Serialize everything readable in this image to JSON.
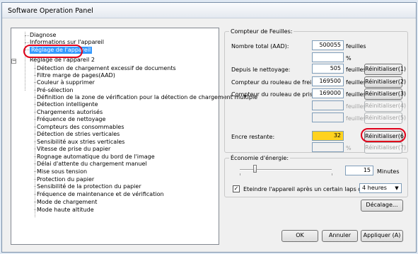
{
  "window": {
    "title": "Software Operation Panel"
  },
  "tree": {
    "expander_glyph": "−",
    "items": [
      "Diagnose",
      "Informations sur l'appareil",
      "Réglage de l'appareil",
      "Réglage de l'appareil 2",
      "Détection de chargement excessif de documents",
      "Filtre marge de pages(AAD)",
      "Couleur à supprimer",
      "Pré-sélection",
      "Définition de la zone de vérification pour la détection de chargement multiple",
      "Détection intelligente",
      "Chargements autorisés",
      "Fréquence de nettoyage",
      "Compteurs des consommables",
      "Détection de stries verticales",
      "Sensibilité aux stries verticales",
      "Vitesse de prise du papier",
      "Rognage automatique du bord de l'image",
      "Délai d'attente du chargement manuel",
      "Mise sous tension",
      "Protection du papier",
      "Sensibilité de la protection du papier",
      "Fréquence de maintenance et de vérification",
      "Mode de chargement",
      "Mode haute altitude"
    ]
  },
  "counter": {
    "legend": "Compteur de Feuilles:",
    "total_label": "Nombre total (AAD):",
    "total_value": "500055",
    "total_unit": "feuilles",
    "percent_unit": "%",
    "since_cleaning_label": "Depuis le nettoyage:",
    "since_cleaning_value": "505",
    "since_cleaning_unit": "feuilles",
    "reset1": "Réinitialiser(1)",
    "brake_label": "Compteur du rouleau de frein:",
    "brake_value": "169500",
    "brake_unit": "feuilles",
    "reset2": "Réinitialiser(2)",
    "pick_label": "Compteur du rouleau de prise :",
    "pick_value": "169000",
    "pick_unit": "feuilles",
    "reset3": "Réinitialiser(3)",
    "blank4_unit": "feuilles",
    "reset4": "Réinitialiser(4)",
    "blank5_unit": "feuilles",
    "reset5": "Réinitialiser(5)",
    "ink_label": "Encre restante:",
    "ink_value": "32",
    "reset6": "Réinitialiser(6)",
    "blank7_unit": "%",
    "reset7": "Réinitialiser(7)"
  },
  "energy": {
    "legend": "Économie d'énergie:",
    "minutes_value": "15",
    "minutes_unit": "Minutes",
    "checkbox_checked": true,
    "checkbox_glyph": "✓",
    "auto_off_label": "Eteindre l'appareil après un certain laps de temps",
    "auto_off_value": "4 heures",
    "dropdown_glyph": "▼"
  },
  "buttons": {
    "offset": "Décalage...",
    "ok": "OK",
    "cancel": "Annuler",
    "apply": "Appliquer (A)"
  },
  "colors": {
    "selection": "#3399ff",
    "highlight_ring": "#e0001a",
    "ink_field": "#ffd21f"
  }
}
